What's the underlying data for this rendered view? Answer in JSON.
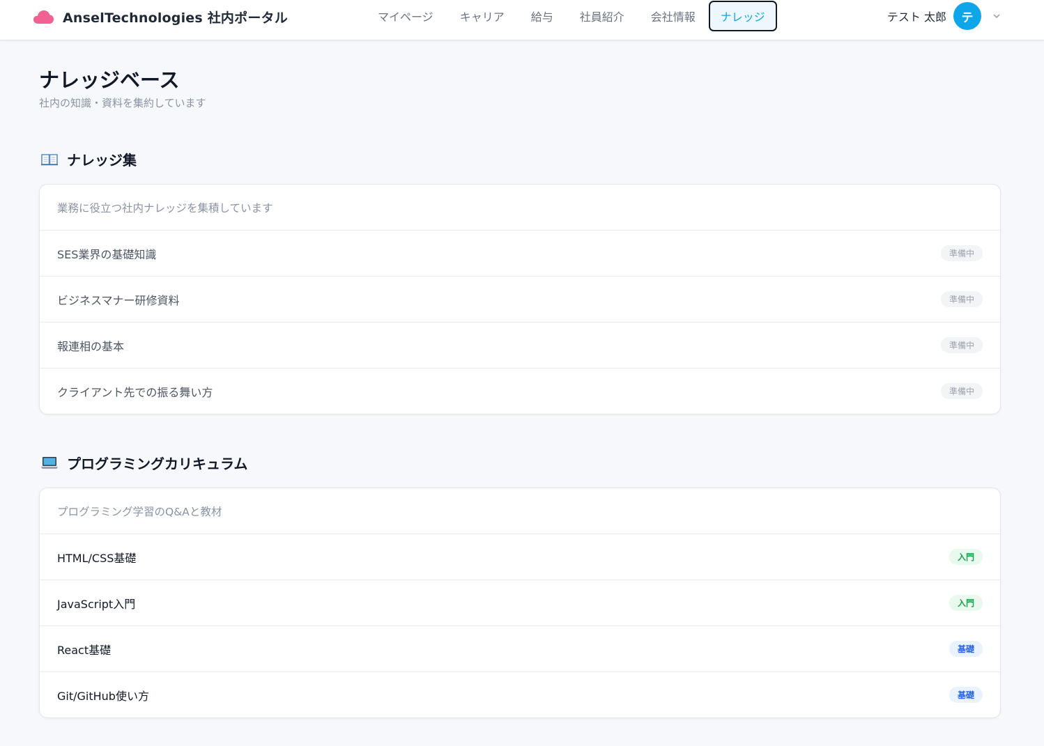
{
  "header": {
    "brand_title": "AnselTechnologies 社内ポータル",
    "brand_icon": "cloud-icon",
    "brand_color": "#f06292",
    "nav": [
      {
        "label": "マイページ",
        "active": false
      },
      {
        "label": "キャリア",
        "active": false
      },
      {
        "label": "給与",
        "active": false
      },
      {
        "label": "社員紹介",
        "active": false
      },
      {
        "label": "会社情報",
        "active": false
      },
      {
        "label": "ナレッジ",
        "active": true
      }
    ],
    "user": {
      "name": "テスト 太郎",
      "avatar_initial": "テ",
      "avatar_color": "#0ea5e9",
      "menu_icon": "chevron-down-icon"
    }
  },
  "page": {
    "title": "ナレッジベース",
    "subtitle": "社内の知識・資料を集約しています"
  },
  "sections": [
    {
      "icon": "open-book-icon",
      "title": "ナレッジ集",
      "description": "業務に役立つ社内ナレッジを集積しています",
      "items": [
        {
          "label": "SES業界の基礎知識",
          "badge": "準備中",
          "badge_type": "pending"
        },
        {
          "label": "ビジネスマナー研修資料",
          "badge": "準備中",
          "badge_type": "pending"
        },
        {
          "label": "報連相の基本",
          "badge": "準備中",
          "badge_type": "pending"
        },
        {
          "label": "クライアント先での振る舞い方",
          "badge": "準備中",
          "badge_type": "pending"
        }
      ]
    },
    {
      "icon": "laptop-icon",
      "title": "プログラミングカリキュラム",
      "description": "プログラミング学習のQ&Aと教材",
      "items": [
        {
          "label": "HTML/CSS基礎",
          "badge": "入門",
          "badge_type": "intro"
        },
        {
          "label": "JavaScript入門",
          "badge": "入門",
          "badge_type": "intro"
        },
        {
          "label": "React基礎",
          "badge": "基礎",
          "badge_type": "basic"
        },
        {
          "label": "Git/GitHub使い方",
          "badge": "基礎",
          "badge_type": "basic"
        }
      ]
    }
  ]
}
